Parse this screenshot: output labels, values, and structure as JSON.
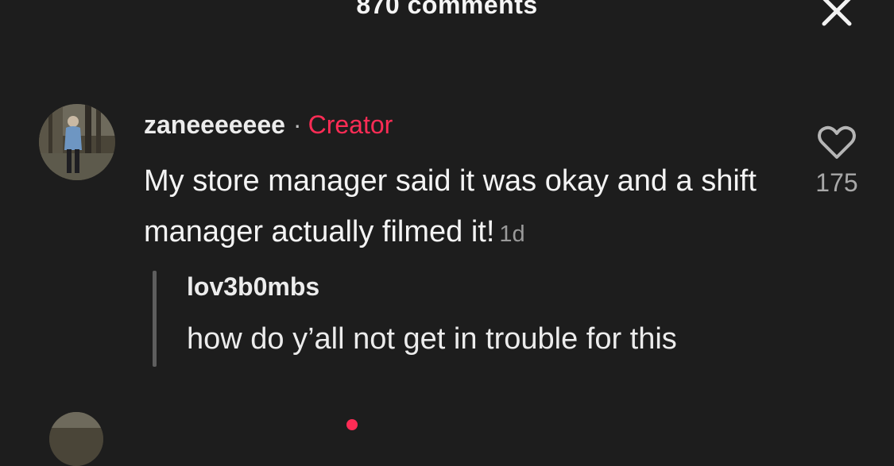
{
  "header": {
    "title": "870 comments",
    "close_icon": "close-icon"
  },
  "comment": {
    "username": "zaneeeeeee",
    "separator": "·",
    "badge": "Creator",
    "text": "My store manager said it was okay and a shift manager actually filmed it!",
    "timestamp": "1d",
    "likes": "175",
    "like_icon": "heart-outline-icon",
    "avatar_icon": "profile-photo"
  },
  "reply_quote": {
    "username": "lov3b0mbs",
    "text": "how do y’all not get in trouble for this"
  },
  "colors": {
    "background": "#1d1d1d",
    "creator_badge": "#fe2c55",
    "secondary_text": "#9a9a9a"
  }
}
